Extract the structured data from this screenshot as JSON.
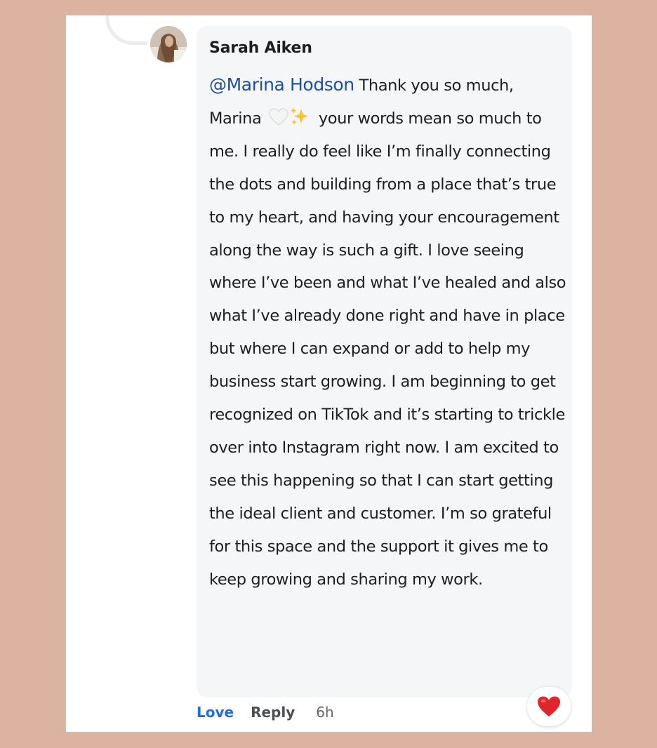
{
  "comment": {
    "author": "Sarah Aiken",
    "mention": "@Marina Hodson",
    "text_part1": " Thank you so much, Marina ",
    "emoji_white_heart": "white-heart-icon",
    "emoji_sparkles": "sparkles-icon",
    "text_part2": " your words mean so much to me. I really do feel like I’m finally connecting the dots and building from a place that’s true to my heart, and having your encouragement along the way is such a gift. I love seeing where I’ve been and what I’ve healed and also what I’ve already done right and have in place but where I can expand or add to help my business start growing. I am beginning to get recognized on TikTok and it’s starting to trickle over into Instagram right now. I am excited to see this happening so that I can start getting the ideal client and customer. I’m so grateful for this space and the support it gives me to keep growing and sharing my work."
  },
  "actions": {
    "love_label": "Love",
    "reply_label": "Reply",
    "timestamp": "6h"
  },
  "reaction": {
    "icon": "red-heart-icon",
    "color": "#e0262b"
  },
  "colors": {
    "background": "#dcb3a1",
    "bubble": "#f5f6f7",
    "mention": "#1e4fa3",
    "love": "#1e6fd9"
  }
}
